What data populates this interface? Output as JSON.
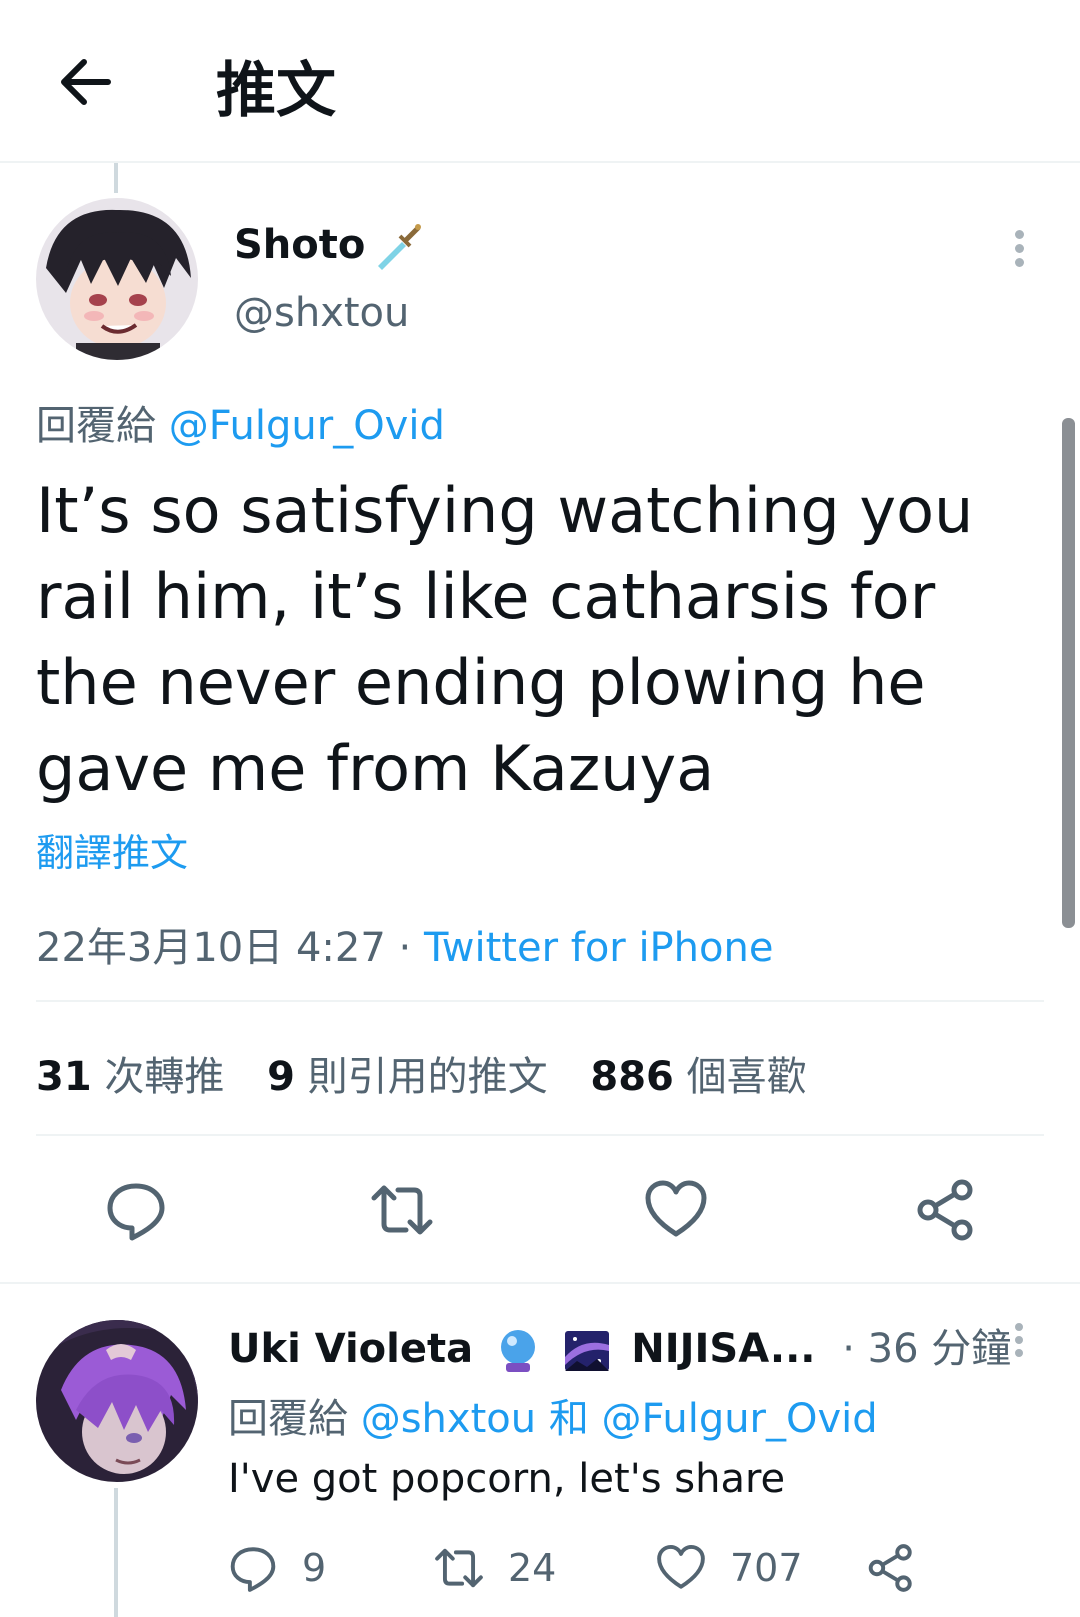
{
  "header": {
    "title": "推文"
  },
  "tweet": {
    "display_name": "Shoto",
    "handle": "@shxtou",
    "reply_to_label": "回覆給",
    "reply_to_mention": "@Fulgur_Ovid",
    "text": "It’s so satisfying watching you rail him, it’s like catharsis for the never ending plowing he gave me from Kazuya",
    "translate_label": "翻譯推文",
    "timestamp": "22年3月10日 4:27",
    "meta_separator": " · ",
    "source": "Twitter for iPhone",
    "stats": {
      "retweets_count": "31",
      "retweets_label": "次轉推",
      "quotes_count": "9",
      "quotes_label": "則引用的推文",
      "likes_count": "886",
      "likes_label": "個喜歡"
    }
  },
  "reply": {
    "display_name": "Uki Violeta",
    "name_suffix": "NIJISA...",
    "time": "· 36 分鐘",
    "reply_to_label": "回覆給",
    "mention_1": "@shxtou",
    "and_label": "和",
    "mention_2": "@Fulgur_Ovid",
    "text": "I've got popcorn, let's share",
    "counts": {
      "replies": "9",
      "retweets": "24",
      "likes": "707"
    }
  },
  "colors": {
    "link": "#1d9bf0",
    "secondary_text": "#536471",
    "icon": "#536471",
    "divider": "#eff3f4"
  },
  "icons": [
    "back-arrow",
    "sword",
    "more-vertical",
    "reply",
    "retweet",
    "like",
    "share",
    "crystal-ball",
    "galaxy"
  ]
}
